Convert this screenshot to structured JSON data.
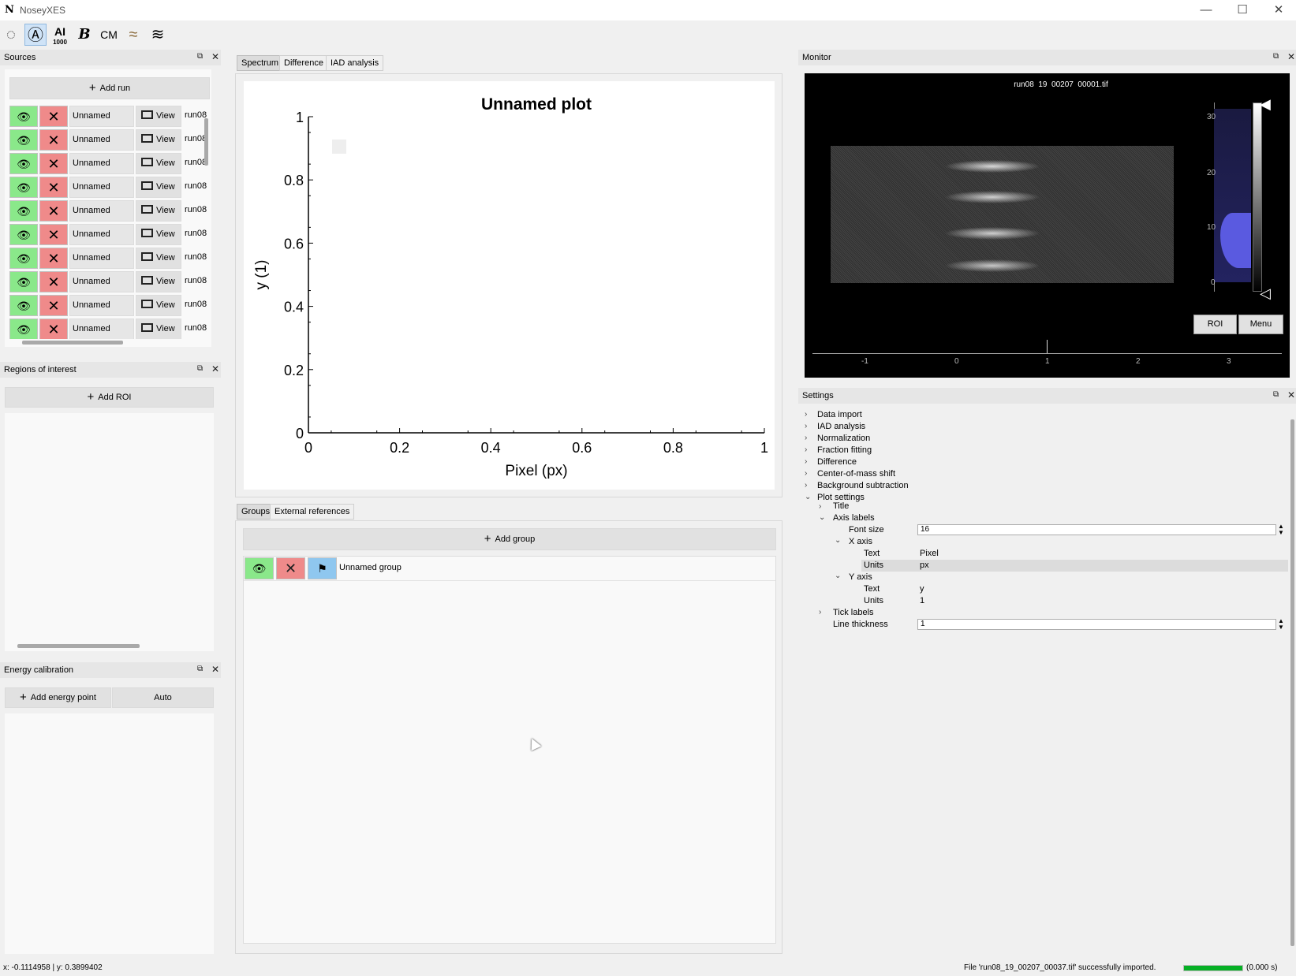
{
  "window": {
    "logo": "N",
    "title": "NoseyXES",
    "minimize": "—",
    "maximize": "☐",
    "close": "✕"
  },
  "toolbar": {
    "tools": [
      {
        "name": "select-tool-icon",
        "glyph": "◌"
      },
      {
        "name": "auto-icon",
        "glyph": "Ⓐ"
      },
      {
        "name": "ai-icon",
        "glyph": "AI",
        "sub": "1000"
      },
      {
        "name": "bold-icon",
        "glyph": "B"
      },
      {
        "name": "cm-icon",
        "glyph": "CM"
      },
      {
        "name": "spectrum-icon",
        "glyph": "≈"
      },
      {
        "name": "waves-icon",
        "glyph": "≋"
      }
    ]
  },
  "sources": {
    "title": "Sources",
    "add_label": "Add run",
    "rows": [
      {
        "name": "Unnamed",
        "view": "View",
        "file": "run08_"
      },
      {
        "name": "Unnamed",
        "view": "View",
        "file": "run08_"
      },
      {
        "name": "Unnamed",
        "view": "View",
        "file": "run08_"
      },
      {
        "name": "Unnamed",
        "view": "View",
        "file": "run08_"
      },
      {
        "name": "Unnamed",
        "view": "View",
        "file": "run08_"
      },
      {
        "name": "Unnamed",
        "view": "View",
        "file": "run08_"
      },
      {
        "name": "Unnamed",
        "view": "View",
        "file": "run08_"
      },
      {
        "name": "Unnamed",
        "view": "View",
        "file": "run08_"
      },
      {
        "name": "Unnamed",
        "view": "View",
        "file": "run08_"
      },
      {
        "name": "Unnamed",
        "view": "View",
        "file": "run08_"
      }
    ]
  },
  "roi": {
    "title": "Regions of interest",
    "add_label": "Add ROI"
  },
  "energy": {
    "title": "Energy calibration",
    "add_label": "Add energy point",
    "auto_label": "Auto"
  },
  "center_tabs": {
    "tabs": [
      "Spectrum",
      "Difference",
      "IAD analysis"
    ]
  },
  "chart_data": {
    "type": "line",
    "title": "Unnamed plot",
    "xlabel": "Pixel (px)",
    "ylabel": "y (1)",
    "xlim": [
      0,
      1
    ],
    "ylim": [
      0,
      1
    ],
    "x_ticks": [
      "0",
      "0.2",
      "0.4",
      "0.6",
      "0.8",
      "1"
    ],
    "y_ticks": [
      "0",
      "0.2",
      "0.4",
      "0.6",
      "0.8",
      "1"
    ],
    "series": [],
    "legend": "top-left"
  },
  "groups_tabs": {
    "tabs": [
      "Groups",
      "External references"
    ]
  },
  "groups": {
    "add_label": "Add group",
    "rows": [
      {
        "name": "Unnamed group"
      }
    ]
  },
  "monitor": {
    "title": "Monitor",
    "image_title": "run08  19  00207  00001.tif",
    "hist_ticks": [
      "30",
      "20",
      "10",
      "0"
    ],
    "x_ticks": [
      "-1",
      "0",
      "1",
      "2",
      "3"
    ],
    "roi_label": "ROI",
    "menu_label": "Menu"
  },
  "settings": {
    "title": "Settings",
    "items": [
      {
        "label": "Data import",
        "expanded": false
      },
      {
        "label": "IAD analysis",
        "expanded": false
      },
      {
        "label": "Normalization",
        "expanded": false
      },
      {
        "label": "Fraction fitting",
        "expanded": false
      },
      {
        "label": "Difference",
        "expanded": false
      },
      {
        "label": "Center-of-mass shift",
        "expanded": false
      },
      {
        "label": "Background subtraction",
        "expanded": false
      },
      {
        "label": "Plot settings",
        "expanded": true
      }
    ],
    "plot": {
      "title_label": "Title",
      "axis_labels": "Axis labels",
      "font_size_label": "Font size",
      "font_size_value": "16",
      "x_axis": "X axis",
      "x_text_label": "Text",
      "x_text_value": "Pixel",
      "x_units_label": "Units",
      "x_units_value": "px",
      "y_axis": "Y axis",
      "y_text_label": "Text",
      "y_text_value": "y",
      "y_units_label": "Units",
      "y_units_value": "1",
      "tick_labels": "Tick labels",
      "line_thickness_label": "Line thickness",
      "line_thickness_value": "1"
    }
  },
  "status": {
    "coords": "x: -0.1114958 | y: 0.3899402",
    "message": "File 'run08_19_00207_00037.tif' successfully imported.",
    "progress": 1.0,
    "elapsed": "(0.000 s)"
  }
}
